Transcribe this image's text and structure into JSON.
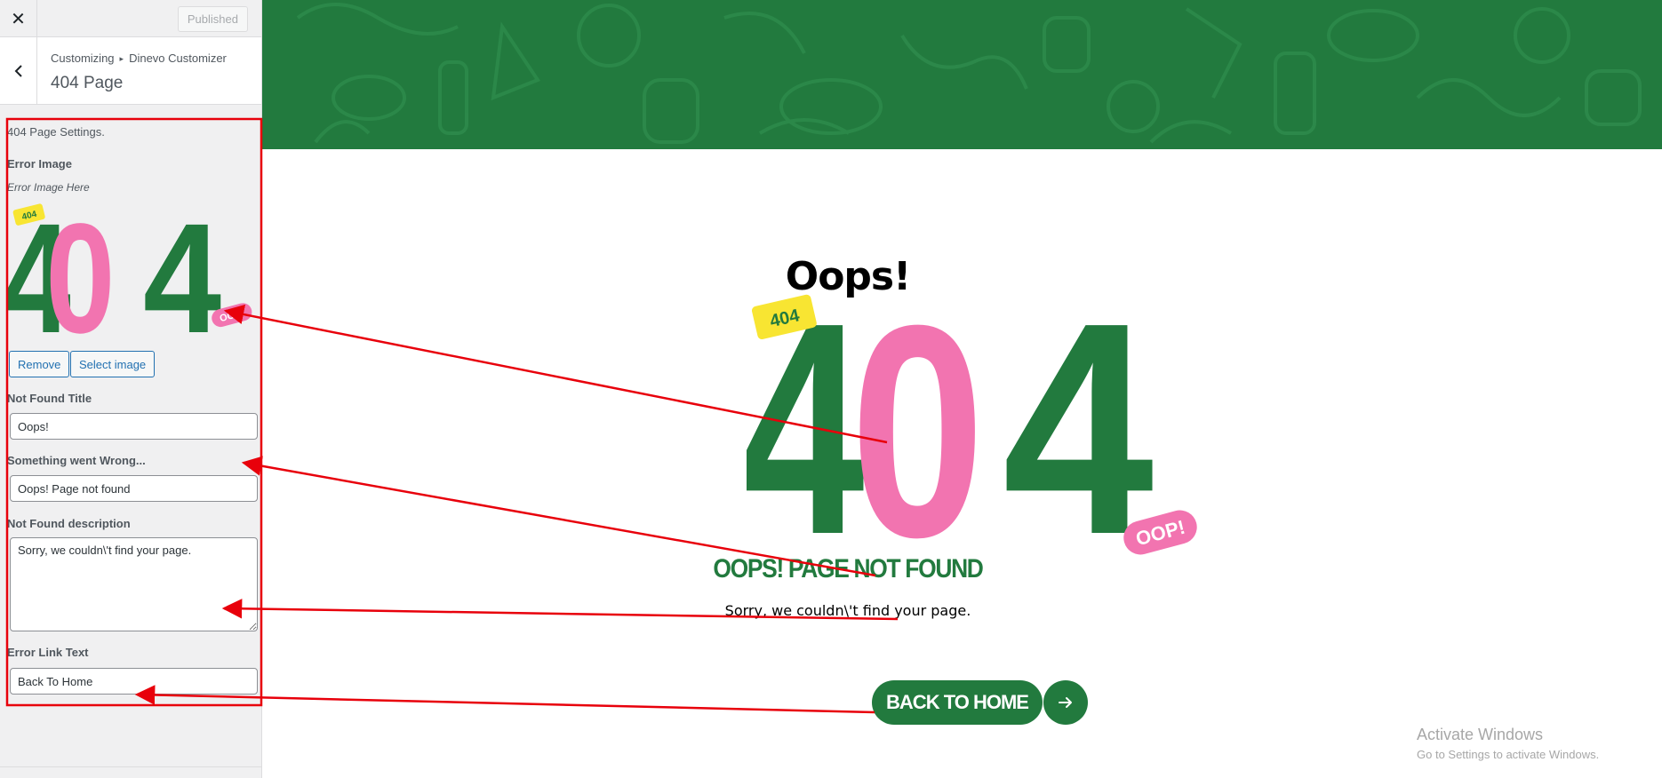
{
  "topbar": {
    "close_icon": "close-icon",
    "published_label": "Published"
  },
  "section": {
    "breadcrumb_root": "Customizing",
    "breadcrumb_separator": "▸",
    "breadcrumb_parent": "Dinevo Customizer",
    "title": "404 Page"
  },
  "controls": {
    "description": "404 Page Settings.",
    "error_image": {
      "label": "Error Image",
      "sublabel": "Error Image Here",
      "remove_label": "Remove",
      "select_label": "Select image"
    },
    "not_found_title": {
      "label": "Not Found Title",
      "value": "Oops!"
    },
    "something_wrong": {
      "label": "Something went Wrong...",
      "value": "Oops! Page not found"
    },
    "not_found_description": {
      "label": "Not Found description",
      "value": "Sorry, we couldn\\'t find your page."
    },
    "error_link_text": {
      "label": "Error Link Text",
      "value": "Back To Home"
    }
  },
  "preview": {
    "title": "Oops!",
    "big_number": "404",
    "tag_small": "404",
    "tag_oop": "OOP!",
    "subtitle": "OOPS! PAGE NOT FOUND",
    "description": "Sorry, we couldn\\'t find your page.",
    "button_label": "BACK TO HOME",
    "button_icon": "arrow-right-icon"
  },
  "watermark": {
    "title": "Activate Windows",
    "subtitle": "Go to Settings to activate Windows."
  },
  "colors": {
    "brand_green": "#227a3e",
    "brand_pink": "#f274b0",
    "tag_yellow": "#f8e532",
    "annotation_red": "#e8000b"
  }
}
